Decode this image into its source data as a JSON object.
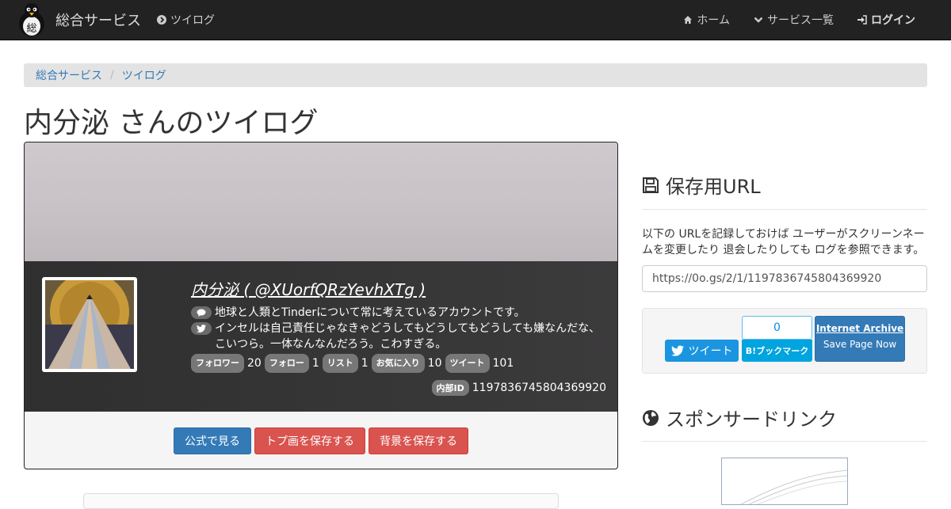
{
  "nav": {
    "brand": "総合サービス",
    "logo_char": "総",
    "current": "ツイログ",
    "items": [
      {
        "label": "ホーム",
        "icon": "home-icon"
      },
      {
        "label": "サービス一覧",
        "icon": "chevron-down-icon"
      },
      {
        "label": "ログイン",
        "icon": "sign-in-icon"
      }
    ]
  },
  "breadcrumb": [
    "総合サービス",
    "ツイログ"
  ],
  "page_title": "内分泌 さんのツイログ",
  "profile": {
    "display_name": "内分泌 ( @XUorfQRzYevhXTg )",
    "bio": "地球と人類とTinderについて常に考えているアカウントです。",
    "tweet": "インセルは自己責任じゃなきゃどうしてもどうしてもどうしても嫌なんだな、こいつら。一体なんなんだろう。こわすぎる。",
    "stats": [
      {
        "label": "フォロワー",
        "value": "20"
      },
      {
        "label": "フォロー",
        "value": "1"
      },
      {
        "label": "リスト",
        "value": "1"
      },
      {
        "label": "お気に入り",
        "value": "10"
      },
      {
        "label": "ツイート",
        "value": "101"
      }
    ],
    "internal_id_label": "内部ID",
    "internal_id": "1197836745804369920"
  },
  "buttons": {
    "official": "公式で見る",
    "save_avatar": "トプ画を保存する",
    "save_banner": "背景を保存する"
  },
  "sidebar": {
    "save_heading": "保存用URL",
    "save_desc": "以下の URLを記録しておけば ユーザーがスクリーンネームを変更したり 退会したりしても ログを参照できます。",
    "save_url": "https://0o.gs/2/1/1197836745804369920",
    "tweet_label": "ツイート",
    "hatena_count": "0",
    "hatena_label": "B!ブックマーク",
    "ia_title": "Internet Archive",
    "ia_sub": "Save Page Now",
    "sponsor_heading": "スポンサードリンク"
  },
  "colors": {
    "navbar": "#222222",
    "primary": "#337ab7",
    "danger": "#d9534f",
    "twitter": "#1b95e0",
    "hatena": "#00a4de"
  }
}
